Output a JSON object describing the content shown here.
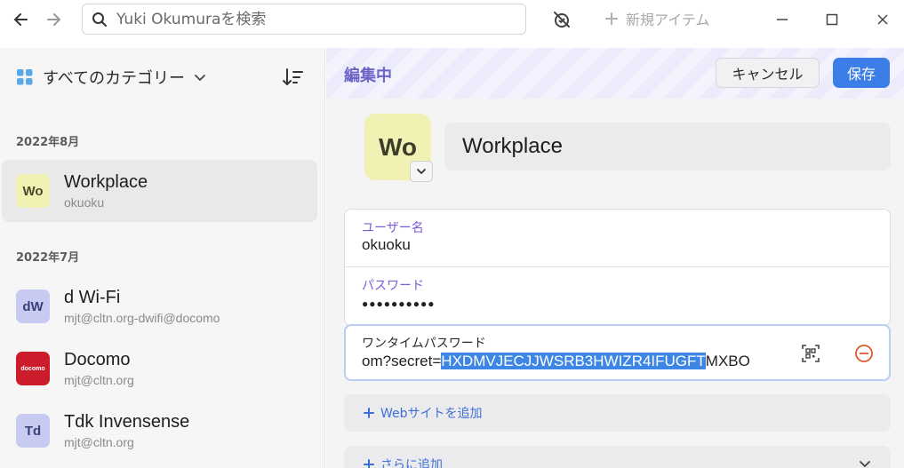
{
  "topbar": {
    "search_placeholder": "Yuki Okumuraを検索",
    "new_item_label": "新規アイテム"
  },
  "sidebar": {
    "category_label": "すべてのカテゴリー",
    "groups": [
      {
        "label": "2022年8月"
      },
      {
        "label": "2022年7月"
      }
    ],
    "items": [
      {
        "avatar": "Wo",
        "title": "Workplace",
        "subtitle": "okuoku",
        "avatar_bg": "#f1f1b4",
        "avatar_fg": "#4a4a2a"
      },
      {
        "avatar": "dW",
        "title": "d Wi-Fi",
        "subtitle": "mjt@cltn.org-dwifi@docomo",
        "avatar_bg": "#c7cbf1",
        "avatar_fg": "#3a3f7a"
      },
      {
        "avatar": "docomo",
        "title": "Docomo",
        "subtitle": "mjt@cltn.org",
        "avatar_bg": "#cc1b2a",
        "avatar_fg": "#ffffff"
      },
      {
        "avatar": "Td",
        "title": "Tdk Invensense",
        "subtitle": "mjt@cltn.org",
        "avatar_bg": "#c7cbf1",
        "avatar_fg": "#3a3f7a"
      }
    ]
  },
  "editor": {
    "status_label": "編集中",
    "cancel_label": "キャンセル",
    "save_label": "保存",
    "avatar": "Wo",
    "title_value": "Workplace",
    "username_label": "ユーザー名",
    "username_value": "okuoku",
    "password_label": "パスワード",
    "password_value": "●●●●●●●●●●",
    "otp_label": "ワンタイムパスワード",
    "otp_prefix": "om?secret=",
    "otp_selected": "HXDMVJECJJWSRB3HWIZR4IFUGFT",
    "otp_suffix": "MXBO",
    "add_website_label": "Webサイトを追加",
    "add_more_label": "さらに追加"
  },
  "colors": {
    "accent": "#3b7ee8",
    "edit_label": "#6c63c7",
    "field_label": "#7c5cd6",
    "link": "#3e6fd8",
    "remove": "#e05a2a"
  }
}
